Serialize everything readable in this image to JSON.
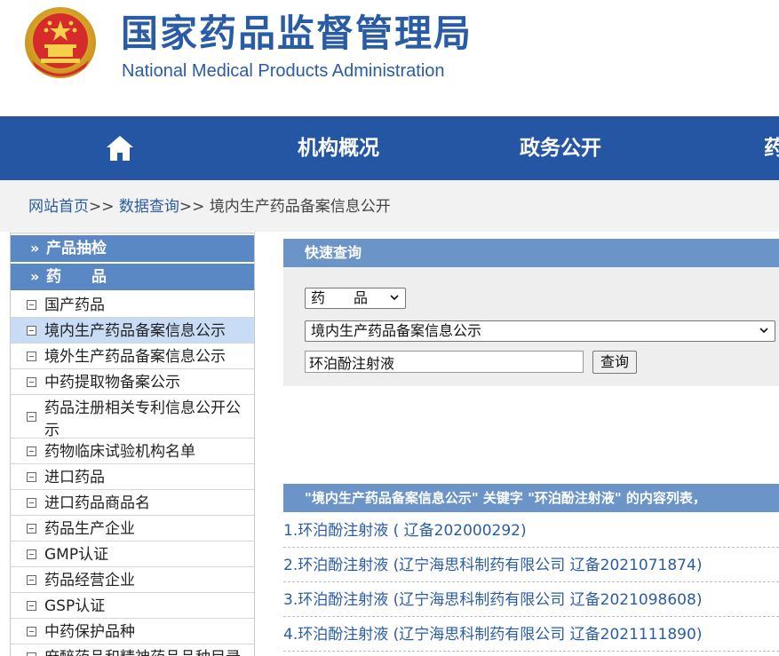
{
  "header": {
    "title_cn": "国家药品监督管理局",
    "title_en": "National Medical Products Administration"
  },
  "nav": {
    "items": [
      "机构概况",
      "政务公开",
      "药"
    ]
  },
  "breadcrumb": {
    "home": "网站首页",
    "sep": ">>",
    "data_query": "数据查询",
    "current": "境内生产药品备案信息公开"
  },
  "sidebar": {
    "sections": [
      {
        "label": "产品抽检"
      },
      {
        "label": "药　　品"
      }
    ],
    "arrow": "»",
    "items": [
      {
        "label": "国产药品"
      },
      {
        "label": "境内生产药品备案信息公示"
      },
      {
        "label": "境外生产药品备案信息公示"
      },
      {
        "label": "中药提取物备案公示"
      },
      {
        "label": "药品注册相关专利信息公开公示"
      },
      {
        "label": "药物临床试验机构名单"
      },
      {
        "label": "进口药品"
      },
      {
        "label": "进口药品商品名"
      },
      {
        "label": "药品生产企业"
      },
      {
        "label": "GMP认证"
      },
      {
        "label": "药品经营企业"
      },
      {
        "label": "GSP认证"
      },
      {
        "label": "中药保护品种"
      },
      {
        "label": "麻醉药品和精神药品品种目录"
      }
    ]
  },
  "quick_query": {
    "title": "快速查询",
    "category_value": "药　　品",
    "subcategory_value": "境内生产药品备案信息公示",
    "search_value": "环泊酚注射液",
    "search_button": "查询"
  },
  "results": {
    "heading": "\"境内生产药品备案信息公示\" 关键字 \"环泊酚注射液\" 的内容列表，",
    "rows": [
      "1.环泊酚注射液 ( 辽备202000292)",
      "2.环泊酚注射液 (辽宁海思科制药有限公司 辽备2021071874)",
      "3.环泊酚注射液 (辽宁海思科制药有限公司 辽备2021098608)",
      "4.环泊酚注射液 (辽宁海思科制药有限公司 辽备2021111890)"
    ]
  },
  "colors": {
    "brand_blue": "#2556a4",
    "panel_blue": "#6b95c8",
    "link_blue": "#2a5ca6"
  }
}
